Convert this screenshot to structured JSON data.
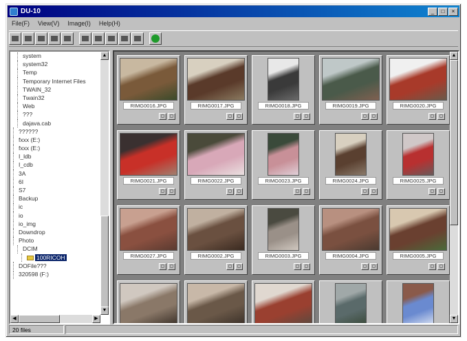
{
  "window": {
    "title": "DU-10",
    "controls": [
      "_",
      "□",
      "×"
    ]
  },
  "menu": [
    "File(F)",
    "View(V)",
    "Image(I)",
    "Help(H)"
  ],
  "toolbar": {
    "groups": [
      [
        "back-icon",
        "up-folder-icon",
        "folder-view-icon",
        "pen-icon",
        "pointer-icon"
      ],
      [
        "single-view-icon",
        "two-pane-icon",
        "grid-view-icon",
        "split-view-icon",
        "list-view-icon"
      ],
      [
        "refresh-icon"
      ]
    ]
  },
  "tree": {
    "items": [
      {
        "label": "system",
        "level": 1
      },
      {
        "label": "system32",
        "level": 1
      },
      {
        "label": "Temp",
        "level": 1
      },
      {
        "label": "Temporary Internet Files",
        "level": 1
      },
      {
        "label": "TWAIN_32",
        "level": 1
      },
      {
        "label": "Twain32",
        "level": 1
      },
      {
        "label": "Web",
        "level": 1
      },
      {
        "label": "???",
        "level": 1
      },
      {
        "label": "dajava.cab",
        "level": 1
      },
      {
        "label": "??????",
        "level": 0
      },
      {
        "label": "fxxx (E:)",
        "level": 0
      },
      {
        "label": "fxxx (E:)",
        "level": 0
      },
      {
        "label": "I_ldb",
        "level": 0
      },
      {
        "label": "I_cdb",
        "level": 0
      },
      {
        "label": "3A",
        "level": 0
      },
      {
        "label": "6I",
        "level": 0
      },
      {
        "label": "S7",
        "level": 0
      },
      {
        "label": "Backup",
        "level": 0
      },
      {
        "label": "ic",
        "level": 0
      },
      {
        "label": "io",
        "level": 0
      },
      {
        "label": "io_img",
        "level": 0
      },
      {
        "label": "Downdrop",
        "level": 0
      },
      {
        "label": "Photo",
        "level": 0
      },
      {
        "label": "DCIM",
        "level": 1
      },
      {
        "label": "100RICOH",
        "level": 2,
        "selected": true
      },
      {
        "label": "DOFile???",
        "level": 0
      },
      {
        "label": "320598 (F:)",
        "level": 0
      }
    ]
  },
  "gallery": {
    "tiles": [
      {
        "filename": "RIMG0016.JPG",
        "orientation": "wide",
        "colors": [
          "#7a5a3a",
          "#c8b8a0",
          "#3a4a2a"
        ]
      },
      {
        "filename": "RIMG0017.JPG",
        "orientation": "wide",
        "colors": [
          "#5a3a2a",
          "#d8d0c0",
          "#8a7a60"
        ]
      },
      {
        "filename": "RIMG0018.JPG",
        "orientation": "tall",
        "colors": [
          "#3a3a3a",
          "#e8e8e8",
          "#6a6a6a"
        ]
      },
      {
        "filename": "RIMG0019.JPG",
        "orientation": "wide",
        "colors": [
          "#4a5a4a",
          "#bfc8c8",
          "#806050"
        ]
      },
      {
        "filename": "RIMG0020.JPG",
        "orientation": "wide",
        "colors": [
          "#a83a2a",
          "#f0f0f0",
          "#6a5a4a"
        ]
      },
      {
        "filename": "RIMG0021.JPG",
        "orientation": "wide",
        "colors": [
          "#c83028",
          "#3a3030",
          "#a08070"
        ]
      },
      {
        "filename": "RIMG0022.JPG",
        "orientation": "wide",
        "colors": [
          "#d8a8b8",
          "#4a4a3a",
          "#eae0e0"
        ]
      },
      {
        "filename": "RIMG0023.JPG",
        "orientation": "tall",
        "colors": [
          "#c89098",
          "#3a4a3a",
          "#e0d0d8"
        ]
      },
      {
        "filename": "RIMG0024.JPG",
        "orientation": "tall",
        "colors": [
          "#5a4030",
          "#d8d0c0",
          "#8a7a6a"
        ]
      },
      {
        "filename": "RIMG0025.JPG",
        "orientation": "tall",
        "colors": [
          "#b83030",
          "#d0c8c8",
          "#6a5a5a"
        ]
      },
      {
        "filename": "RIMG0027.JPG",
        "orientation": "wide",
        "colors": [
          "#8a5040",
          "#c8a090",
          "#5a3a30"
        ]
      },
      {
        "filename": "RIMG0002.JPG",
        "orientation": "wide",
        "colors": [
          "#6a5040",
          "#c0b0a0",
          "#3a2a20"
        ]
      },
      {
        "filename": "RIMG0003.JPG",
        "orientation": "tall",
        "colors": [
          "#9a9088",
          "#4a4a40",
          "#d0c8c0"
        ]
      },
      {
        "filename": "RIMG0004.JPG",
        "orientation": "wide",
        "colors": [
          "#7a5040",
          "#b89080",
          "#4a3a30"
        ]
      },
      {
        "filename": "RIMG0005.JPG",
        "orientation": "wide",
        "colors": [
          "#6a4030",
          "#d8c8b0",
          "#4a6a3a"
        ]
      },
      {
        "filename": "",
        "orientation": "wide",
        "colors": [
          "#8a7868",
          "#d0c8c0",
          "#3a3028"
        ]
      },
      {
        "filename": "",
        "orientation": "wide",
        "colors": [
          "#6a5848",
          "#c8b8a8",
          "#3a3028"
        ]
      },
      {
        "filename": "",
        "orientation": "wide",
        "colors": [
          "#9a4030",
          "#e0d8d0",
          "#5a4a40"
        ]
      },
      {
        "filename": "",
        "orientation": "tall",
        "colors": [
          "#5a6a6a",
          "#a0a8a8",
          "#3a4a3a"
        ]
      },
      {
        "filename": "",
        "orientation": "tall",
        "colors": [
          "#6a8ad0",
          "#8a5a4a",
          "#d8e0f0"
        ]
      }
    ],
    "tile_buttons": [
      "▢",
      "▢"
    ]
  },
  "status": {
    "text": "20 files"
  }
}
